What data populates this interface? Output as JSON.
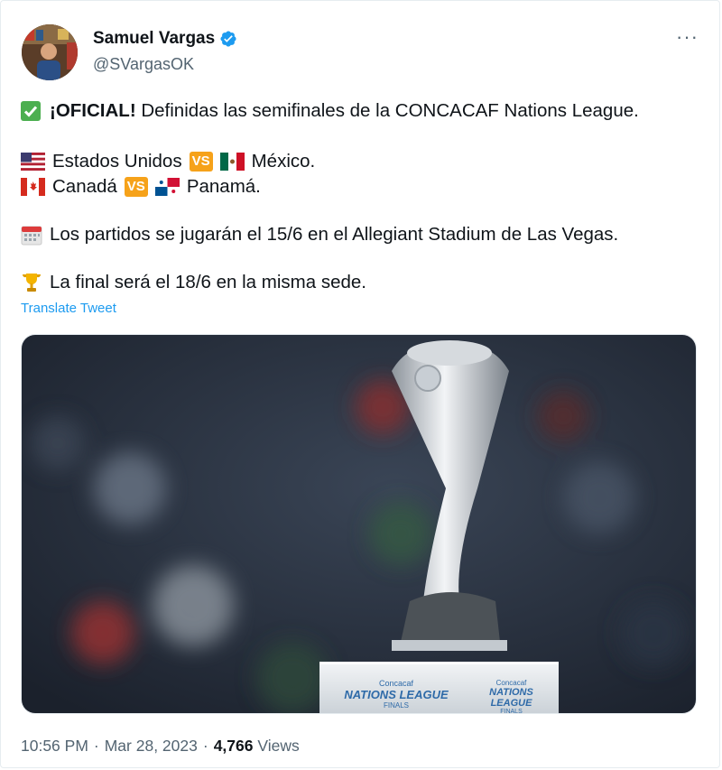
{
  "author": {
    "name": "Samuel Vargas",
    "handle": "@SVargasOK",
    "verified_icon": "verified-badge-icon",
    "more_label": "···"
  },
  "tweet": {
    "line1": {
      "icon": "check-mark-emoji",
      "bold": "¡OFICIAL!",
      "text": " Definidas las semifinales de la CONCACAF Nations League."
    },
    "line2": {
      "flag1": "usa-flag-emoji",
      "team1": "Estados Unidos",
      "vs": "VS",
      "flag2": "mexico-flag-emoji",
      "team2": "México."
    },
    "line3": {
      "flag1": "canada-flag-emoji",
      "team1": "Canadá",
      "vs": "VS",
      "flag2": "panama-flag-emoji",
      "team2": "Panamá."
    },
    "line4": {
      "icon": "calendar-emoji",
      "text": "Los partidos se jugarán el 15/6 en el Allegiant Stadium de Las Vegas."
    },
    "line5": {
      "icon": "trophy-emoji",
      "text": "La final será el 18/6 en la misma sede."
    },
    "translate": "Translate Tweet"
  },
  "media": {
    "pedestal_brand_small": "Concacaf",
    "pedestal_brand": "NATIONS LEAGUE",
    "pedestal_sub": "FINALS"
  },
  "footer": {
    "time": "10:56 PM",
    "separator": "·",
    "date": "Mar 28, 2023",
    "views_count": "4,766",
    "views_label": "Views"
  },
  "colors": {
    "link": "#1d9bf0",
    "secondary_text": "#536471",
    "vs_badge": "#f6a21a"
  }
}
